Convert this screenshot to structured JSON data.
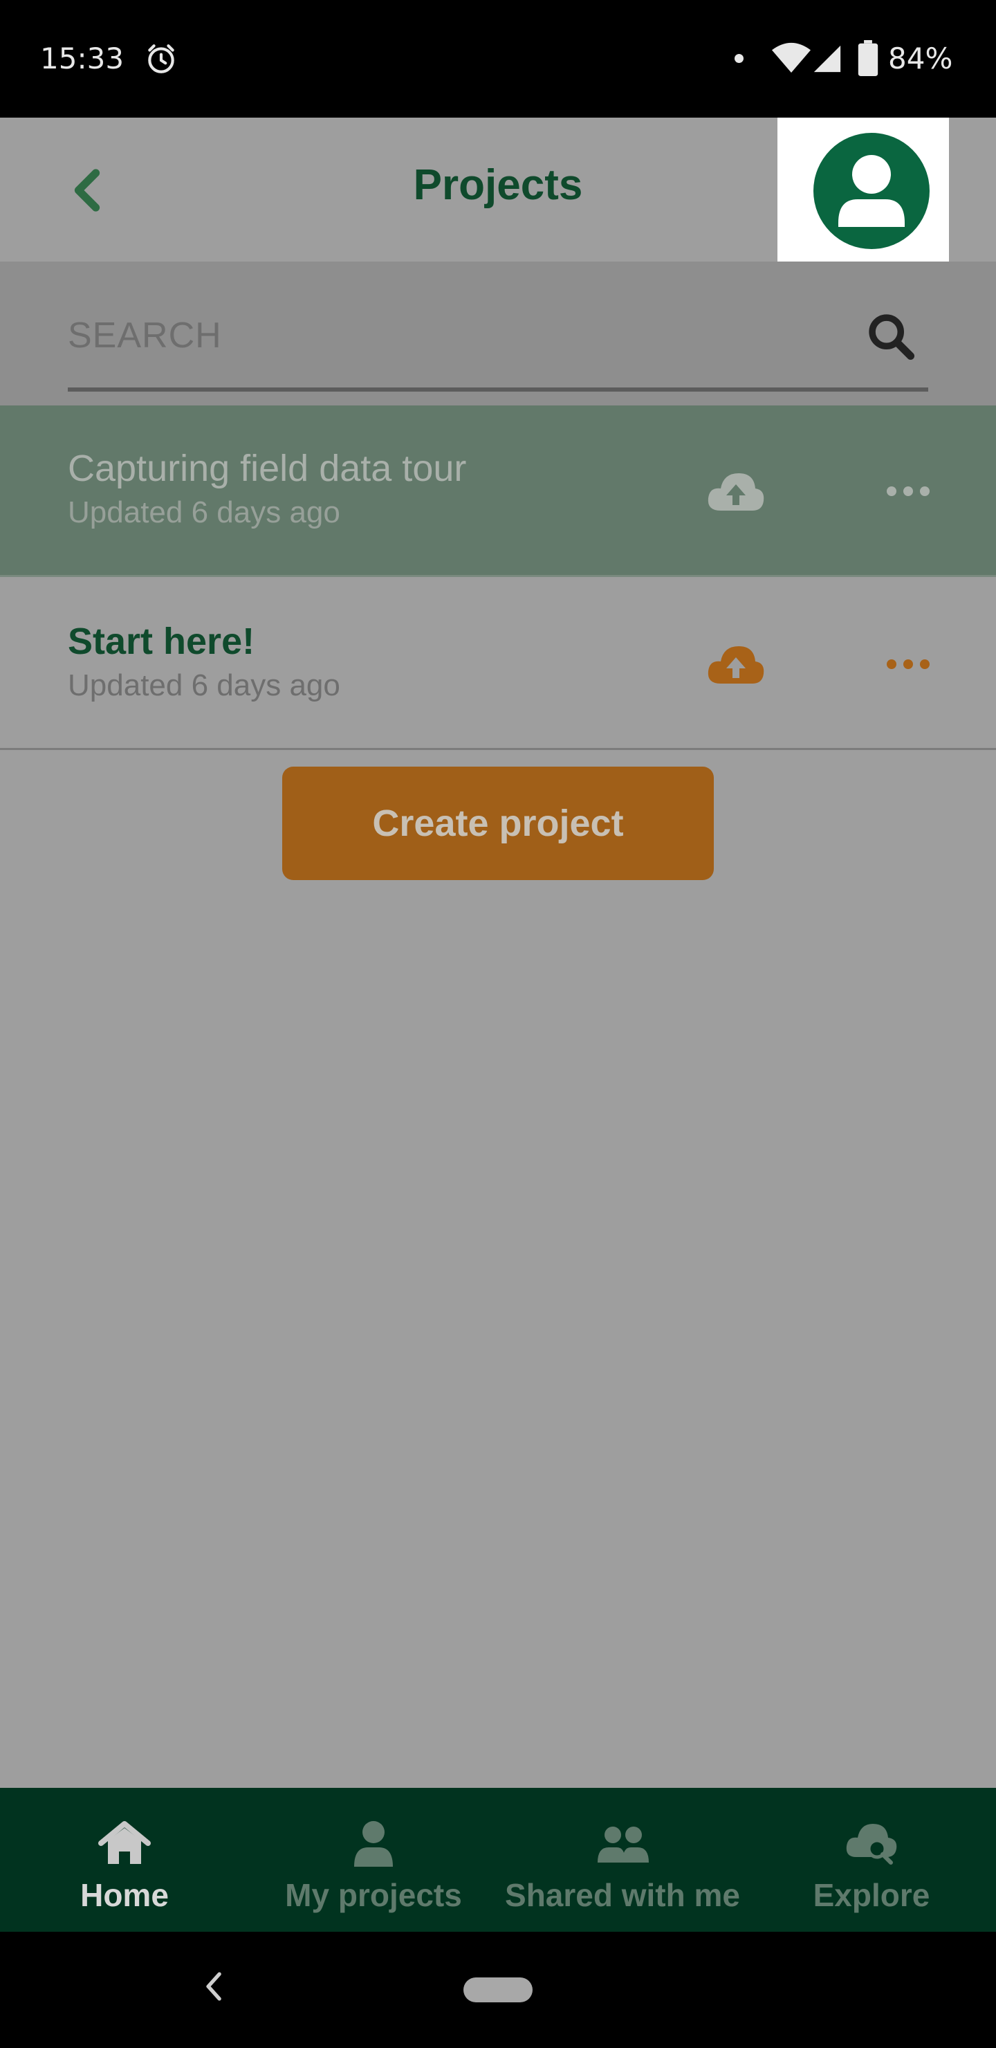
{
  "status_bar": {
    "time": "15:33",
    "battery": "84%",
    "icons": [
      "alarm-icon",
      "notification-dot-icon",
      "wifi-icon",
      "cell-signal-icon",
      "battery-icon"
    ]
  },
  "header": {
    "title": "Projects",
    "back_icon": "chevron-left-icon",
    "profile_icon": "user-avatar-icon"
  },
  "search": {
    "placeholder": "SEARCH",
    "value": "",
    "icon": "search-icon"
  },
  "projects": [
    {
      "name": "Capturing field data tour",
      "updated": "Updated 6 days ago",
      "sync_icon": "cloud-upload-icon",
      "menu_icon": "more-horizontal-icon",
      "selected": true
    },
    {
      "name": "Start here!",
      "updated": "Updated 6 days ago",
      "sync_icon": "cloud-upload-icon",
      "menu_icon": "more-horizontal-icon",
      "selected": false
    }
  ],
  "create_button": {
    "label": "Create project"
  },
  "bottom_nav": {
    "items": [
      {
        "label": "Home",
        "icon": "home-icon",
        "active": true
      },
      {
        "label": "My projects",
        "icon": "user-icon",
        "active": false
      },
      {
        "label": "Shared with me",
        "icon": "users-icon",
        "active": false
      },
      {
        "label": "Explore",
        "icon": "cloud-search-icon",
        "active": false
      }
    ]
  },
  "colors": {
    "brand_green": "#0a6640",
    "title_green": "#0f4a2c",
    "nav_bg": "#01331f",
    "accent_orange": "#a05f18",
    "overlay_gray": "#9e9e9e"
  }
}
